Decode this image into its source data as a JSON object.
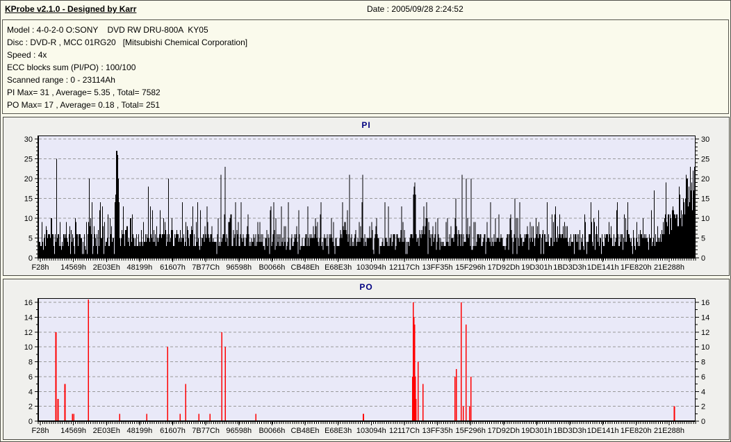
{
  "header": {
    "title": "KProbe v2.1.0 - Designed by Karr",
    "date_label": "Date : 2005/09/28 2:24:52"
  },
  "info": {
    "lines": [
      "Model : 4-0-2-0 O:SONY    DVD RW DRU-800A  KY05",
      "Disc : DVD-R , MCC 01RG20   [Mitsubishi Chemical Corporation]",
      "Speed : 4x",
      "ECC blocks sum (PI/PO) : 100/100",
      "Scanned range : 0 - 23114Ah",
      "PI Max= 31 , Average= 5.35 , Total= 7582",
      "PO Max= 17 , Average= 0.18 , Total= 251"
    ]
  },
  "colors": {
    "page_bg": "#FAFAEC",
    "panel_bg": "#F0F0ED",
    "plot_bg": "#E9E9F8",
    "grid": "#999999",
    "axis": "#000000",
    "pi_bar": "#000000",
    "po_bar": "#FF0000",
    "title_text": "#000080",
    "label_text": "#000000"
  },
  "chart_data": [
    {
      "id": "pi",
      "type": "bar",
      "title": "PI",
      "color": "#000000",
      "ylim": [
        0,
        30
      ],
      "yticks": [
        0,
        5,
        10,
        15,
        20,
        25,
        30
      ],
      "grid": "dashed-horizontal",
      "stats": {
        "max": 31,
        "average": 5.35,
        "total": 7582
      },
      "x_labels": [
        "F28h",
        "14569h",
        "2E03Eh",
        "48199h",
        "61607h",
        "7B77Ch",
        "96598h",
        "B0066h",
        "CB48Eh",
        "E68E3h",
        "103094h",
        "12117Ch",
        "13FF35h",
        "15F296h",
        "17D92Dh",
        "19D301h",
        "1BD3D3h",
        "1DE141h",
        "1FE820h",
        "21E288h"
      ],
      "baseline": {
        "seed": 20050928,
        "bars": 946,
        "base_min": 3,
        "base_range": 4,
        "dip_chance": 0.1,
        "spike_chance": 0.3,
        "spike_range": 5,
        "rare_chance": 0.055,
        "rare_base": 9,
        "rare_range": 6,
        "tail_start": 0.935,
        "cap": 27
      },
      "spikes": [
        [
          0.026,
          25
        ],
        [
          0.076,
          20
        ],
        [
          0.092,
          12
        ],
        [
          0.115,
          14
        ],
        [
          0.116,
          16
        ],
        [
          0.117,
          27
        ],
        [
          0.118,
          28
        ],
        [
          0.119,
          27
        ],
        [
          0.12,
          26
        ],
        [
          0.121,
          20
        ],
        [
          0.122,
          14
        ],
        [
          0.166,
          18
        ],
        [
          0.197,
          20
        ],
        [
          0.218,
          14
        ],
        [
          0.277,
          21
        ],
        [
          0.284,
          23
        ],
        [
          0.352,
          12
        ],
        [
          0.38,
          14
        ],
        [
          0.43,
          14
        ],
        [
          0.473,
          21
        ],
        [
          0.493,
          21
        ],
        [
          0.57,
          16
        ],
        [
          0.571,
          18
        ],
        [
          0.572,
          20
        ],
        [
          0.573,
          19
        ],
        [
          0.574,
          16
        ],
        [
          0.586,
          13
        ],
        [
          0.635,
          15
        ],
        [
          0.644,
          21
        ],
        [
          0.651,
          20
        ],
        [
          0.658,
          20
        ],
        [
          0.725,
          15
        ],
        [
          0.787,
          13
        ],
        [
          0.832,
          11
        ],
        [
          0.88,
          12
        ],
        [
          0.938,
          17
        ],
        [
          0.956,
          19
        ]
      ]
    },
    {
      "id": "po",
      "type": "bar",
      "title": "PO",
      "color": "#FF0000",
      "ylim": [
        0,
        16
      ],
      "yticks": [
        0,
        2,
        4,
        6,
        8,
        10,
        12,
        14,
        16
      ],
      "grid": "dashed-horizontal",
      "stats": {
        "max": 17,
        "average": 0.18,
        "total": 251
      },
      "x_labels": [
        "F28h",
        "14569h",
        "2E03Eh",
        "48199h",
        "61607h",
        "7B77Ch",
        "96598h",
        "B0066h",
        "CB48Eh",
        "E68E3h",
        "103094h",
        "12117Ch",
        "13FF35h",
        "15F296h",
        "17D92Dh",
        "19D301h",
        "1BD3D3h",
        "1DE141h",
        "1FE820h",
        "21E288h"
      ],
      "baseline": null,
      "spikes": [
        [
          0.0254,
          12
        ],
        [
          0.0285,
          3
        ],
        [
          0.0391,
          5
        ],
        [
          0.0507,
          1
        ],
        [
          0.0529,
          1
        ],
        [
          0.0751,
          17
        ],
        [
          0.1226,
          1
        ],
        [
          0.1639,
          1
        ],
        [
          0.1956,
          10
        ],
        [
          0.2146,
          1
        ],
        [
          0.2231,
          5
        ],
        [
          0.2431,
          1
        ],
        [
          0.2601,
          1
        ],
        [
          0.278,
          12
        ],
        [
          0.2833,
          10
        ],
        [
          0.3298,
          1
        ],
        [
          0.4937,
          1
        ],
        [
          0.5698,
          6
        ],
        [
          0.5708,
          16
        ],
        [
          0.5719,
          14
        ],
        [
          0.573,
          13
        ],
        [
          0.574,
          6
        ],
        [
          0.5751,
          3
        ],
        [
          0.5782,
          8
        ],
        [
          0.5856,
          5
        ],
        [
          0.6342,
          6
        ],
        [
          0.6364,
          7
        ],
        [
          0.6438,
          16
        ],
        [
          0.647,
          2
        ],
        [
          0.6512,
          13
        ],
        [
          0.6565,
          2
        ],
        [
          0.6586,
          6
        ],
        [
          0.9683,
          2
        ]
      ]
    }
  ]
}
